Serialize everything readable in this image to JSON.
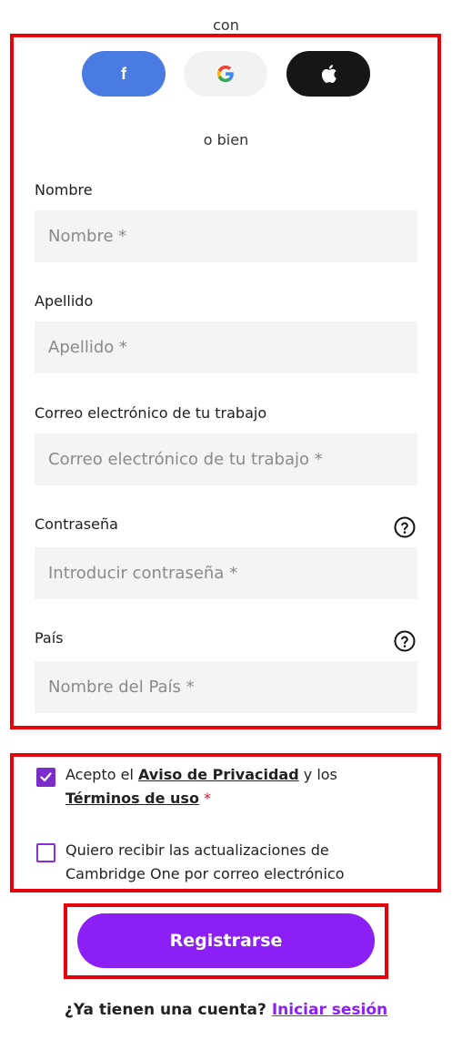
{
  "header": {
    "con_label": "con"
  },
  "social": {
    "facebook_icon": "f",
    "google_icon": "G",
    "apple_icon": "apple-logo"
  },
  "separator": "o bien",
  "form": {
    "first_name": {
      "label": "Nombre",
      "placeholder": "Nombre *",
      "value": ""
    },
    "last_name": {
      "label": "Apellido",
      "placeholder": "Apellido *",
      "value": ""
    },
    "email": {
      "label": "Correo electrónico de tu trabajo",
      "placeholder": "Correo electrónico de tu trabajo *",
      "value": ""
    },
    "password": {
      "label": "Contraseña",
      "placeholder": "Introducir contraseña *",
      "value": ""
    },
    "country": {
      "label": "País",
      "placeholder": "Nombre del País *",
      "value": ""
    }
  },
  "consent": {
    "privacy": {
      "checked": true,
      "prefix": "Acepto el ",
      "privacy_link": "Aviso de Privacidad",
      "middle": " y los",
      "terms_link": "Términos de uso",
      "required_mark": "*"
    },
    "newsletter": {
      "checked": false,
      "text": "Quiero recibir las actualizaciones de Cambridge One por correo electrónico"
    }
  },
  "register_button": "Registrarse",
  "login": {
    "question": "¿Ya tienen una cuenta?",
    "link": "Iniciar sesión"
  },
  "colors": {
    "accent": "#8b1ff5",
    "facebook": "#4a7be3",
    "apple": "#161616",
    "highlight_border": "#e8000b"
  }
}
